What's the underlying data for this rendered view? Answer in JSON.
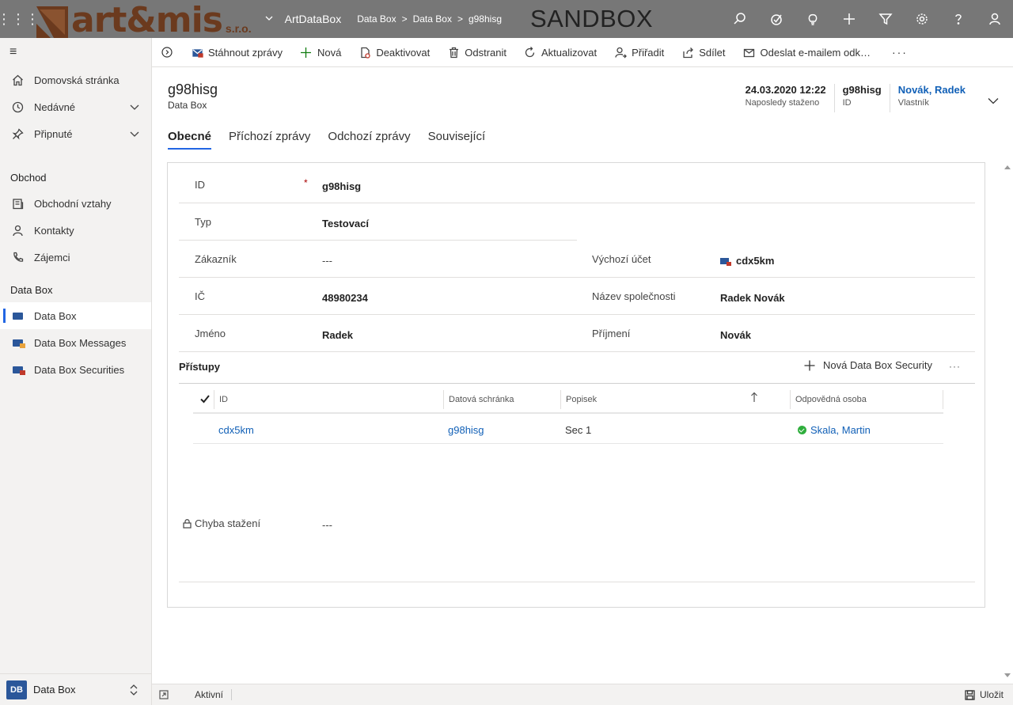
{
  "topbar": {
    "logo_text": "art&mis",
    "logo_suffix": "s.r.o.",
    "app_name": "ArtDataBox",
    "breadcrumb": [
      "Data Box",
      "Data Box",
      "g98hisg"
    ],
    "environment": "SANDBOX",
    "icons": [
      "search-icon",
      "task-icon",
      "lightbulb-icon",
      "plus-icon",
      "filter-icon",
      "gear-icon",
      "help-icon",
      "user-icon"
    ]
  },
  "sidebar": {
    "items_top": [
      {
        "label": "Domovská stránka",
        "icon": "home-icon"
      },
      {
        "label": "Nedávné",
        "icon": "clock-icon"
      },
      {
        "label": "Připnuté",
        "icon": "pin-icon"
      }
    ],
    "section_obchod": "Obchod",
    "items_obchod": [
      {
        "label": "Obchodní vztahy",
        "icon": "building-icon"
      },
      {
        "label": "Kontakty",
        "icon": "person-icon"
      },
      {
        "label": "Zájemci",
        "icon": "phone-icon"
      }
    ],
    "section_databox": "Data Box",
    "items_databox": [
      {
        "label": "Data Box"
      },
      {
        "label": "Data Box Messages"
      },
      {
        "label": "Data Box Securities"
      }
    ],
    "area_badge": "DB",
    "area_label": "Data Box"
  },
  "commands": {
    "download": "Stáhnout zprávy",
    "new": "Nová",
    "deactivate": "Deaktivovat",
    "delete": "Odstranit",
    "refresh": "Aktualizovat",
    "assign": "Přiřadit",
    "share": "Sdílet",
    "email_link": "Odeslat e-mailem odk…",
    "more": "···"
  },
  "header": {
    "title": "g98hisg",
    "entity": "Data Box",
    "fields": [
      {
        "value": "24.03.2020 12:22",
        "label": "Naposledy staženo"
      },
      {
        "value": "g98hisg",
        "label": "ID"
      },
      {
        "value": "Novák, Radek",
        "label": "Vlastník"
      }
    ]
  },
  "tabs": [
    "Obecné",
    "Příchozí zprávy",
    "Odchozí zprávy",
    "Související"
  ],
  "form": {
    "id_label": "ID",
    "id_required": "*",
    "id_value": "g98hisg",
    "type_label": "Typ",
    "type_value": "Testovací",
    "customer_label": "Zákazník",
    "customer_value": "---",
    "account_label": "Výchozí účet",
    "account_value": "cdx5km",
    "ic_label": "IČ",
    "ic_value": "48980234",
    "company_label": "Název společnosti",
    "company_value": "Radek Novák",
    "first_label": "Jméno",
    "first_value": "Radek",
    "last_label": "Příjmení",
    "last_value": "Novák",
    "error_label": "Chyba stažení",
    "error_value": "---"
  },
  "subgrid": {
    "title": "Přístupy",
    "new_label": "Nová Data Box Security",
    "more": "···",
    "columns": [
      "ID",
      "Datová schránka",
      "Popisek",
      "Odpovědná osoba"
    ],
    "rows": [
      {
        "id": "cdx5km",
        "box": "g98hisg",
        "label": "Sec 1",
        "owner": "Skala, Martin"
      }
    ]
  },
  "footer": {
    "status": "Aktivní",
    "save": "Uložit"
  }
}
